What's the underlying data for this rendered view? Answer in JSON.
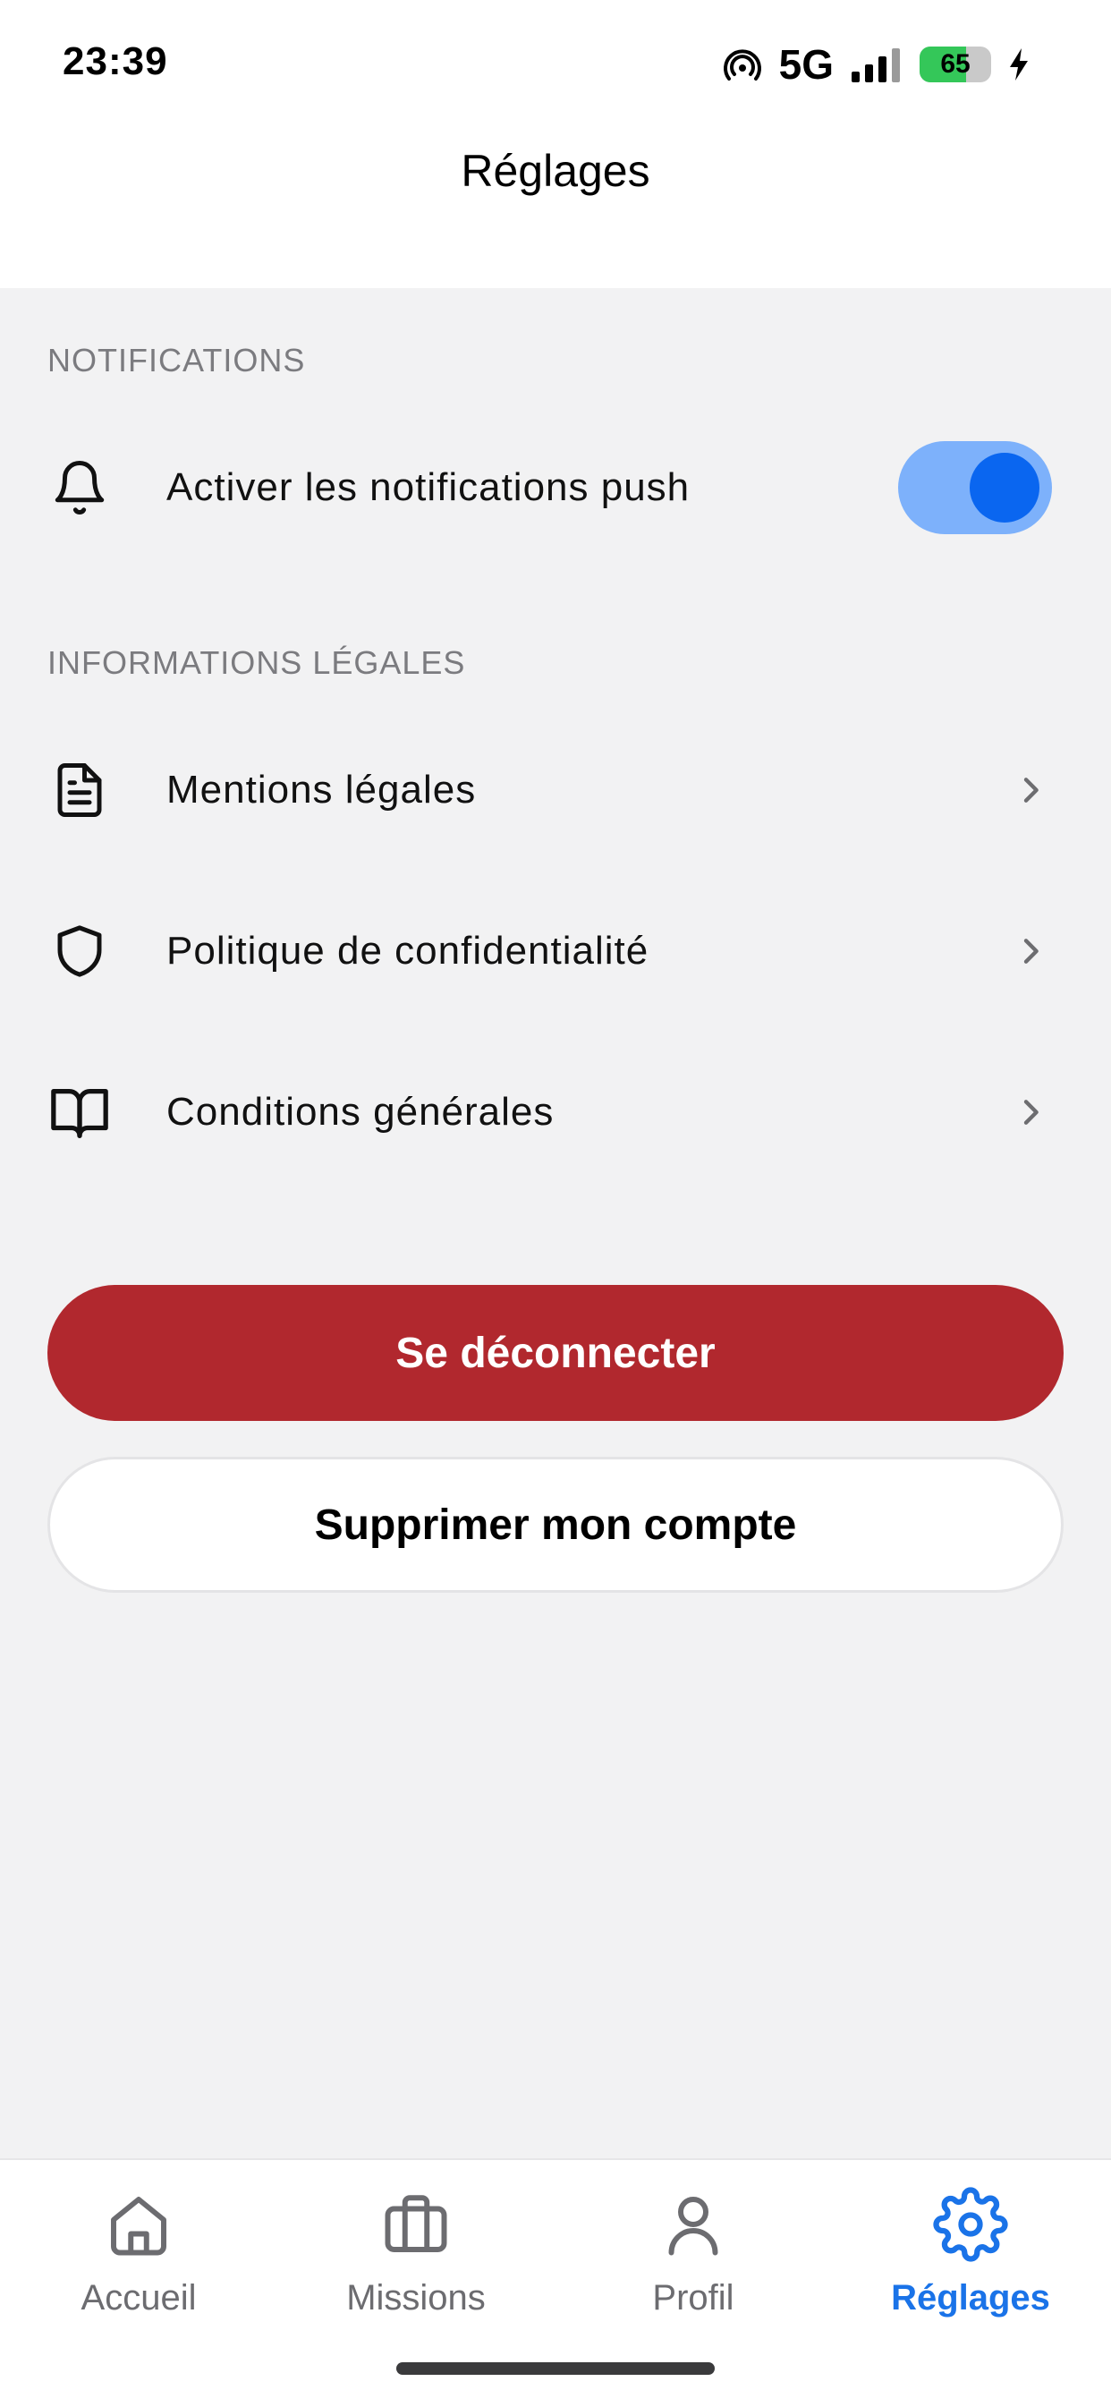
{
  "status_bar": {
    "time": "23:39",
    "network": "5G",
    "battery": "65",
    "battery_level_percent": 65,
    "icons": [
      "hotspot-icon",
      "signal-icon",
      "battery-icon",
      "charging-icon"
    ]
  },
  "header": {
    "title": "Réglages"
  },
  "sections": {
    "notifications": {
      "title": "NOTIFICATIONS",
      "push": {
        "label": "Activer les notifications push",
        "enabled": true,
        "icon": "bell-icon"
      }
    },
    "legal": {
      "title": "INFORMATIONS LÉGALES",
      "items": [
        {
          "label": "Mentions légales",
          "icon": "document-icon"
        },
        {
          "label": "Politique de confidentialité",
          "icon": "shield-icon"
        },
        {
          "label": "Conditions générales",
          "icon": "book-icon"
        }
      ]
    }
  },
  "buttons": {
    "logout": "Se déconnecter",
    "delete_account": "Supprimer mon compte"
  },
  "tabs": [
    {
      "label": "Accueil",
      "icon": "home-icon",
      "active": false
    },
    {
      "label": "Missions",
      "icon": "briefcase-icon",
      "active": false
    },
    {
      "label": "Profil",
      "icon": "user-icon",
      "active": false
    },
    {
      "label": "Réglages",
      "icon": "gear-icon",
      "active": true
    }
  ],
  "colors": {
    "accent": "#1a73e8",
    "toggle_track": "#7db1fb",
    "toggle_knob": "#0a66f0",
    "danger": "#b1282e",
    "background": "#f2f2f3"
  }
}
